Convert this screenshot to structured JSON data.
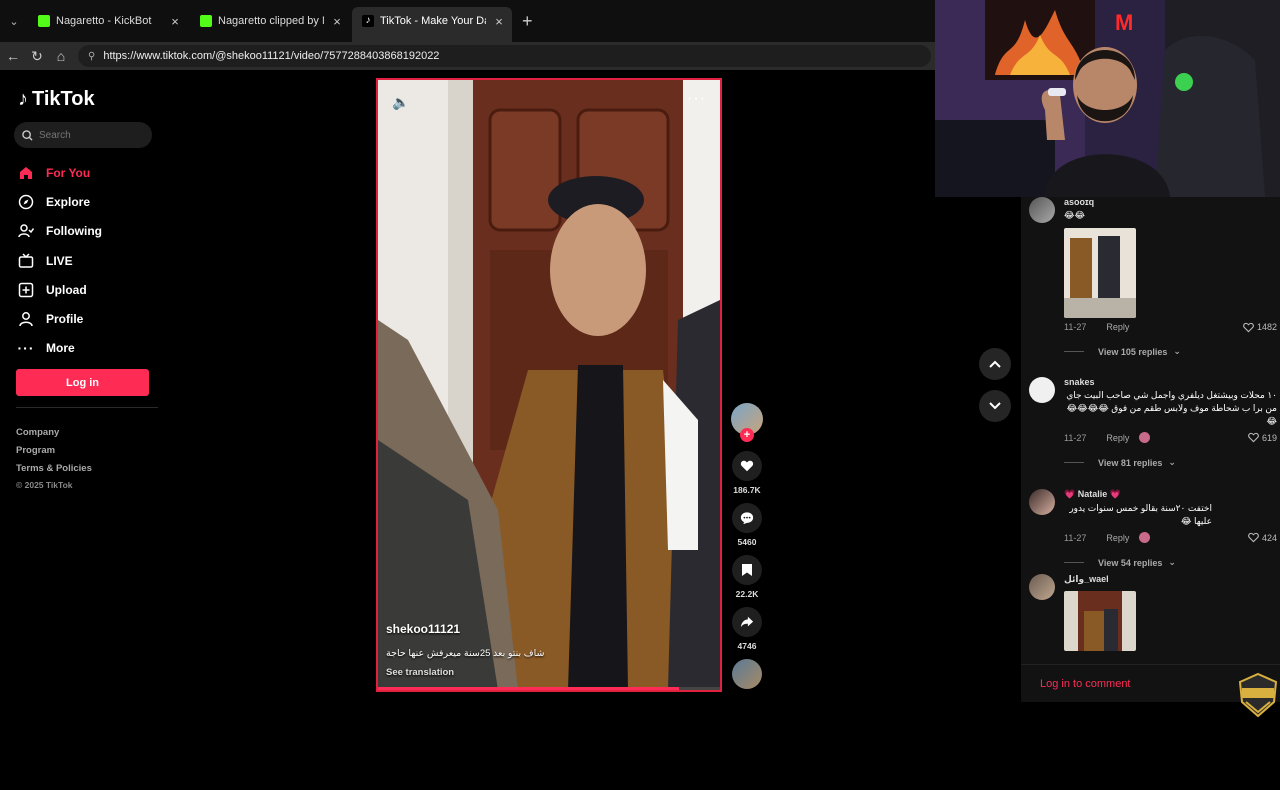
{
  "browser": {
    "tabs": [
      {
        "title": "Nagaretto - KickBot",
        "favicon_color": "#53fc18",
        "active": false
      },
      {
        "title": "Nagaretto clipped by Mohamad_S",
        "favicon_color": "#53fc18",
        "active": false
      },
      {
        "title": "TikTok - Make Your Day",
        "favicon_color": "#ffffff",
        "active": true
      }
    ],
    "new_tab": "+",
    "url": "https://www.tiktok.com/@shekoo11121/video/7577288403868192022"
  },
  "sidebar": {
    "logo_text": "TikTok",
    "search_placeholder": "Search",
    "nav": [
      {
        "label": "For You",
        "icon": "home-icon",
        "active": true
      },
      {
        "label": "Explore",
        "icon": "compass-icon",
        "active": false
      },
      {
        "label": "Following",
        "icon": "following-icon",
        "active": false
      },
      {
        "label": "LIVE",
        "icon": "live-icon",
        "active": false
      },
      {
        "label": "Upload",
        "icon": "upload-icon",
        "active": false
      },
      {
        "label": "Profile",
        "icon": "profile-icon",
        "active": false
      },
      {
        "label": "More",
        "icon": "more-icon",
        "active": false
      }
    ],
    "login_label": "Log in",
    "footer": [
      "Company",
      "Program",
      "Terms & Policies"
    ],
    "copyright": "© 2025 TikTok"
  },
  "video": {
    "author": "shekoo11121",
    "caption": "شاف بنتو بعد 25سنة ميعرفش عنها حاجة",
    "see_translation": "See translation",
    "progress": 0.88
  },
  "actions": {
    "likes": "186.7K",
    "comments": "5460",
    "saves": "22.2K",
    "shares": "4746"
  },
  "comments": [
    {
      "user": "asooɪq",
      "text": "😂😂",
      "date": "11-27",
      "reply": "Reply",
      "likes": "1482",
      "view_replies": "View 105 replies",
      "has_image": true
    },
    {
      "user": "snakes",
      "text": "١٠ محلات وبيشتغل ديلفري واجمل شي صاحب البيت جاي من برا ب شحاطة موف ولابس طقم من فوق 😂😂😂😂😂",
      "date": "11-27",
      "reply": "Reply",
      "likes": "619",
      "view_replies": "View 81 replies",
      "has_image": false
    },
    {
      "user": "💗 Natalie 💗",
      "text": "اختفت ٢٠سنة بقالو خمس سنوات يدور عليها 😂",
      "date": "11-27",
      "reply": "Reply",
      "likes": "424",
      "view_replies": "View 54 replies",
      "has_image": false
    },
    {
      "user": "وائل_wael",
      "text": "",
      "has_image": true
    }
  ],
  "comment_login": "Log in to comment",
  "colors": {
    "accent": "#fe2c55",
    "background": "#000000",
    "panel": "#121212"
  }
}
